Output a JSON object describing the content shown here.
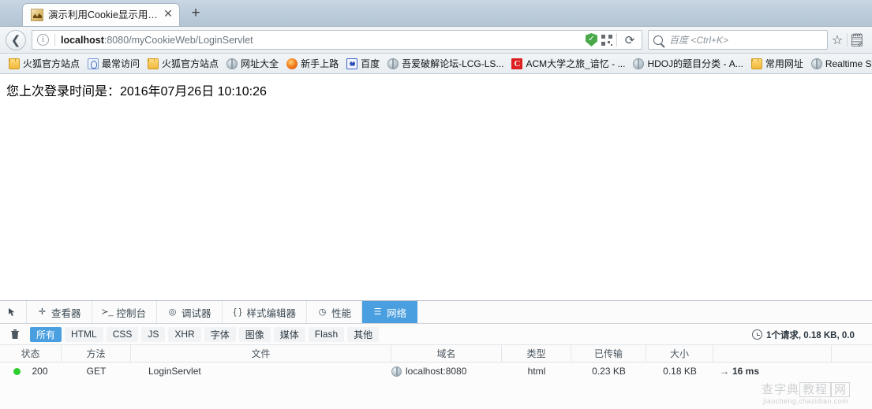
{
  "browser": {
    "tab": {
      "title": "演示利用Cookie显示用户...",
      "close_label": "✕",
      "favicon": "image-favicon"
    },
    "newtab_label": "+",
    "nav": {
      "back_label": "❮",
      "url_prefix": "localhost",
      "url_rest": ":8080/myCookieWeb/LoginServlet",
      "reload_label": "⟳"
    },
    "search": {
      "placeholder": "百度 <Ctrl+K>"
    },
    "bookmarks": [
      {
        "label": "火狐官方站点",
        "icon": "folder-icon",
        "icon_class": "ic-folder"
      },
      {
        "label": "最常访问",
        "icon": "most-visited-icon",
        "icon_class": "ic-blue"
      },
      {
        "label": "火狐官方站点",
        "icon": "folder-icon",
        "icon_class": "ic-folder"
      },
      {
        "label": "网址大全",
        "icon": "globe-icon",
        "icon_class": "ic-globe"
      },
      {
        "label": "新手上路",
        "icon": "firefox-icon",
        "icon_class": "ic-fox"
      },
      {
        "label": "百度",
        "icon": "baidu-icon",
        "icon_class": "ic-baidu"
      },
      {
        "label": "吾爱破解论坛-LCG-LS...",
        "icon": "globe-icon",
        "icon_class": "ic-globe"
      },
      {
        "label": "ACM大学之旅_谙忆 - ...",
        "icon": "csdn-icon",
        "icon_class": "ic-c",
        "icon_text": "C"
      },
      {
        "label": "HDOJ的题目分类 - A...",
        "icon": "globe-icon",
        "icon_class": "ic-globe"
      },
      {
        "label": "常用网址",
        "icon": "folder-icon",
        "icon_class": "ic-folder"
      },
      {
        "label": "Realtime St",
        "icon": "globe-icon",
        "icon_class": "ic-globe"
      }
    ]
  },
  "page": {
    "body_text": "您上次登录时间是：2016年07月26日 10:10:26"
  },
  "devtools": {
    "picker_label": "⬉",
    "tabs": [
      {
        "label": "查看器",
        "icon": "inspector-icon",
        "glyph": "✛",
        "active": false
      },
      {
        "label": "控制台",
        "icon": "console-icon",
        "glyph": "≻_",
        "active": false
      },
      {
        "label": "调试器",
        "icon": "debugger-icon",
        "glyph": "◎",
        "active": false
      },
      {
        "label": "样式编辑器",
        "icon": "style-editor-icon",
        "glyph": "{ }",
        "active": false
      },
      {
        "label": "性能",
        "icon": "performance-icon",
        "glyph": "◷",
        "active": false
      },
      {
        "label": "网络",
        "icon": "network-icon",
        "glyph": "☰",
        "active": true
      }
    ],
    "trash_label": "🗑",
    "filters": [
      {
        "label": "所有",
        "active": true
      },
      {
        "label": "HTML",
        "active": false
      },
      {
        "label": "CSS",
        "active": false
      },
      {
        "label": "JS",
        "active": false
      },
      {
        "label": "XHR",
        "active": false
      },
      {
        "label": "字体",
        "active": false
      },
      {
        "label": "图像",
        "active": false
      },
      {
        "label": "媒体",
        "active": false
      },
      {
        "label": "Flash",
        "active": false
      },
      {
        "label": "其他",
        "active": false
      }
    ],
    "summary": "1个请求, 0.18 KB, 0.0",
    "table": {
      "columns": [
        "状态",
        "方法",
        "文件",
        "域名",
        "类型",
        "已传输",
        "大小",
        ""
      ],
      "rows": [
        {
          "status": "200",
          "method": "GET",
          "file": "LoginServlet",
          "domain": "localhost:8080",
          "type": "html",
          "transferred": "0.23 KB",
          "size": "0.18 KB",
          "time": "16 ms",
          "time_arrow": "→"
        }
      ]
    }
  },
  "watermark": {
    "part1": "查字典",
    "part2": "教程",
    "part3": "网",
    "url": "jiaocheng.chazidian.com"
  },
  "colors": {
    "accent": "#4a9fe0",
    "status_ok": "#2ecc2e",
    "chrome_top": "#c9d6e3"
  }
}
